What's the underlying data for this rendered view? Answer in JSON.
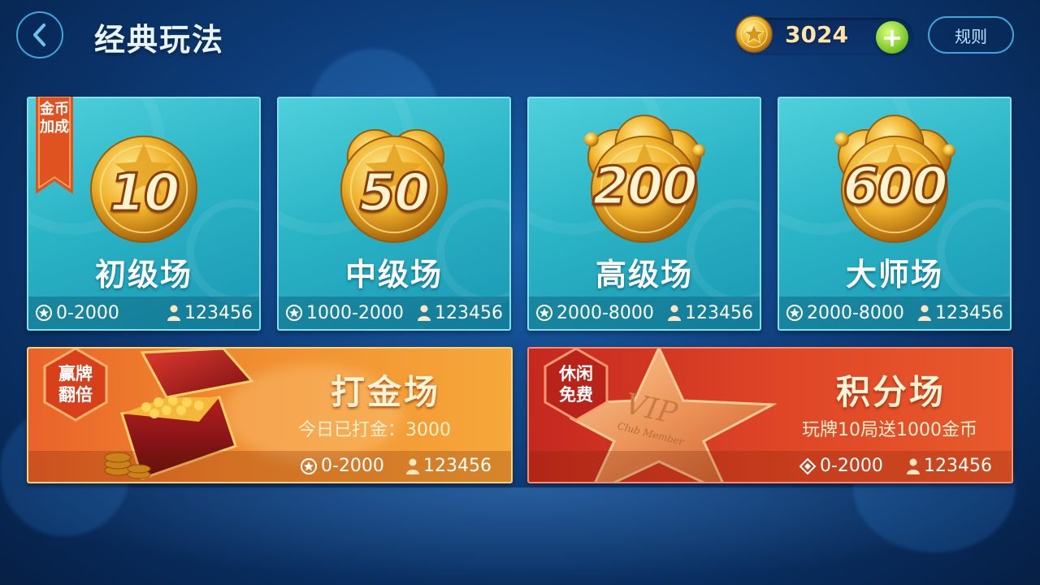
{
  "header": {
    "title": "经典玩法",
    "coins": "3024",
    "add_label": "+",
    "rules_label": "规则"
  },
  "ribbon": {
    "line1": "金币",
    "line2": "加成"
  },
  "rooms": [
    {
      "badge": "10",
      "name": "初级场",
      "range": "0-2000",
      "players": "123456"
    },
    {
      "badge": "50",
      "name": "中级场",
      "range": "1000-2000",
      "players": "123456"
    },
    {
      "badge": "200",
      "name": "高级场",
      "range": "2000-8000",
      "players": "123456"
    },
    {
      "badge": "600",
      "name": "大师场",
      "range": "2000-8000",
      "players": "123456"
    }
  ],
  "wide": [
    {
      "badge_line1": "赢牌",
      "badge_line2": "翻倍",
      "title": "打金场",
      "subtitle": "今日已打金：3000",
      "range": "0-2000",
      "players": "123456"
    },
    {
      "badge_line1": "休闲",
      "badge_line2": "免费",
      "title": "积分场",
      "subtitle": "玩牌10局送1000金币",
      "range": "0-2000",
      "players": "123456",
      "vip_text": "VIP",
      "vip_sub": "Club Member"
    }
  ],
  "colors": {
    "accent_blue": "#3fa6dc",
    "card_teal": "#2bb4c6",
    "gold_card": "#f08a2f",
    "red_card": "#de4526",
    "coin_text": "#ffe3a8"
  }
}
